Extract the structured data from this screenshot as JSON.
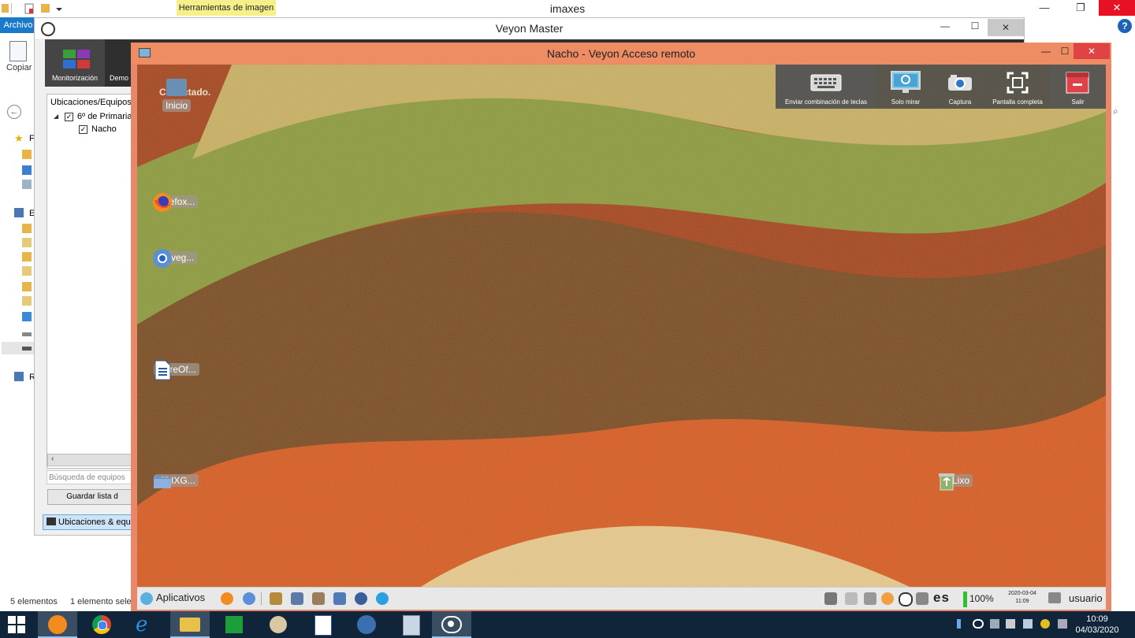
{
  "explorer": {
    "title": "imaxes",
    "context_tab": "Herramientas de imagen",
    "ribbon_tab": "Archivo",
    "copy_label": "Copiar",
    "nav_letters": [
      "F",
      "E",
      "R"
    ],
    "status_count": "5 elementos",
    "status_selected": "1 elemento selec",
    "help": "?"
  },
  "veyon_master": {
    "title": "Veyon Master",
    "toolbar": {
      "monitor_label": "Monitorización",
      "demo_label": "Demo"
    },
    "panel_title": "Ubicaciones/Equipos",
    "tree": {
      "group": "6º de Primaria",
      "computer": "Nacho"
    },
    "search_placeholder": "Búsqueda de equipos",
    "save_button": "Guardar lista d",
    "locations_tab": "Ubicaciones & equi"
  },
  "remote": {
    "title": "Nacho - Veyon Acceso remoto",
    "status": "Conectado.",
    "toolbar": [
      {
        "label": "Enviar combinación de teclas",
        "icon": "keyboard-icon"
      },
      {
        "label": "Solo mirar",
        "icon": "monitor-view-icon"
      },
      {
        "label": "Captura",
        "icon": "camera-icon"
      },
      {
        "label": "Pantalla completa",
        "icon": "fullscreen-icon"
      },
      {
        "label": "Salir",
        "icon": "exit-icon"
      }
    ],
    "desktop_icons": [
      {
        "label": "Inicio",
        "icon": "home-folder-icon"
      },
      {
        "label": "Firefox...",
        "icon": "firefox-icon"
      },
      {
        "label": "Naveg...",
        "icon": "chromium-icon"
      },
      {
        "label": "LibreOf...",
        "icon": "libreoffice-writer-icon"
      },
      {
        "label": "EDIXG...",
        "icon": "folder-icon"
      },
      {
        "label": "Lixo",
        "icon": "trash-icon"
      }
    ],
    "taskbar": {
      "start_label": "Aplicativos",
      "keyboard_layout": "es",
      "battery": "100%",
      "date": "2020-03-04",
      "time": "11:09",
      "user": "usuario"
    }
  },
  "taskbar": {
    "time": "10:09",
    "date": "04/03/2020"
  },
  "colors": {
    "remote_window_border": "#e8886a",
    "taskbar": "#10253a",
    "close_red": "#e81123"
  }
}
